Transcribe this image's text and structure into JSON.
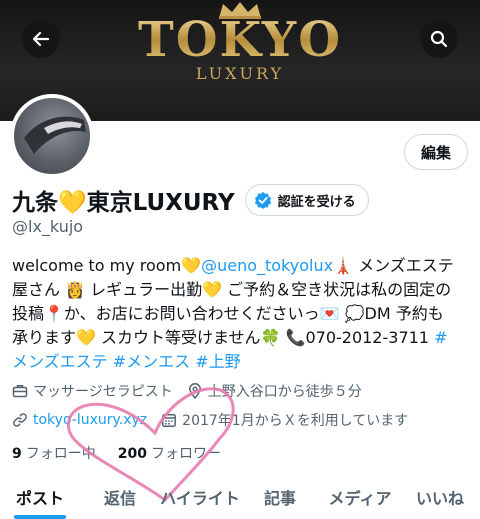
{
  "banner": {
    "logo_main": "TOKYO",
    "logo_sub": "LUXURY"
  },
  "header": {
    "back_icon": "back-arrow-icon",
    "search_icon": "search-icon"
  },
  "profile": {
    "edit_label": "編集",
    "name": "九条💛東京LUXURY",
    "verify_label": "認証を受ける",
    "handle": "@lx_kujo",
    "bio": {
      "l1a": "welcome to my room💛",
      "l1link": "@ueno_tokyolux",
      "l1b": "🗼 メンズエステ",
      "l2": "屋さん 👸 レギュラー出勤💛 ご予約＆空き状況は私の固定の",
      "l3": "投稿📍か、お店にお問い合わせくださいっ💌 💭DM 予約も",
      "l4a": "承ります💛 スカウト等受けません🍀 📞070-2012-3711 ",
      "l4link": "#",
      "l5": "メンズエステ #メンエス #上野"
    },
    "occupation": "マッサージセラピスト",
    "location": "上野入谷口から徒歩５分",
    "website": "tokyo-luxury.xyz",
    "joined": "2017年1月からＸを利用しています",
    "following_count": "9",
    "following_label": "フォロー中",
    "followers_count": "200",
    "followers_label": "フォロワー"
  },
  "tabs": [
    "ポスト",
    "返信",
    "ハイライト",
    "記事",
    "メディア",
    "いいね"
  ],
  "colors": {
    "accent": "#1d9bf0",
    "heart": "#e87bb0"
  }
}
